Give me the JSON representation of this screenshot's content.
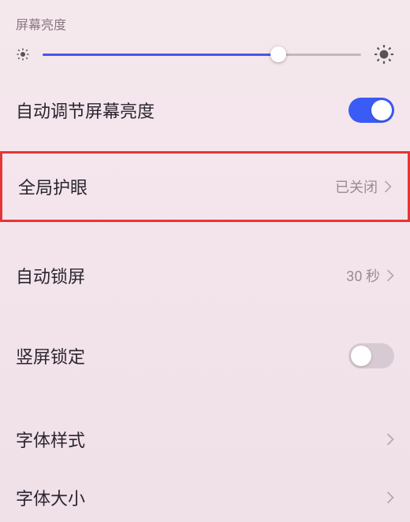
{
  "section": {
    "header": "屏幕亮度"
  },
  "brightness": {
    "slider_value": 74
  },
  "autoBrightness": {
    "label": "自动调节屏幕亮度",
    "enabled": true
  },
  "eyeCare": {
    "label": "全局护眼",
    "value": "已关闭"
  },
  "autoLock": {
    "label": "自动锁屏",
    "value": "30 秒"
  },
  "orientationLock": {
    "label": "竖屏锁定",
    "enabled": false
  },
  "fontStyle": {
    "label": "字体样式"
  },
  "fontSize": {
    "label": "字体大小"
  }
}
